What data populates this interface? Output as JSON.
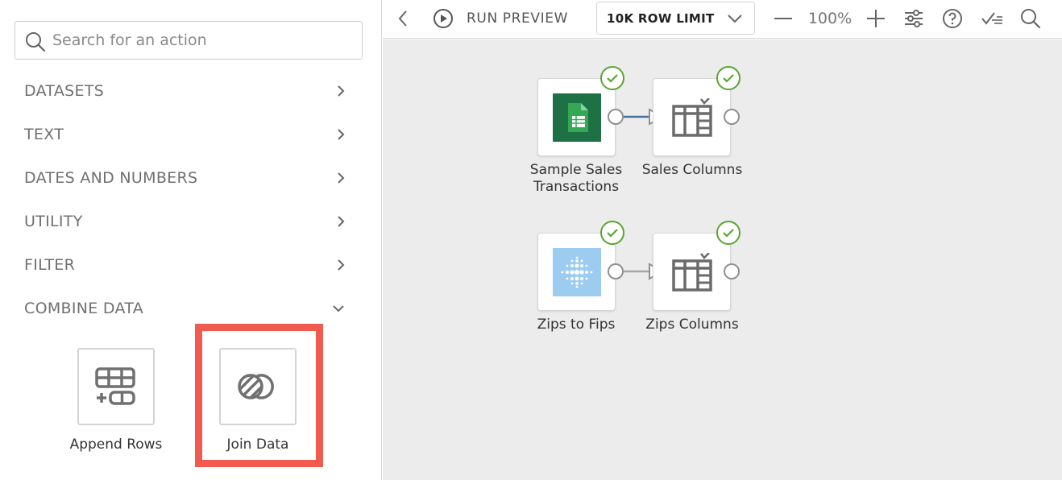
{
  "search": {
    "placeholder": "Search for an action"
  },
  "categories": [
    {
      "label": "DATASETS",
      "icon": "chevron-right-icon"
    },
    {
      "label": "TEXT",
      "icon": "chevron-right-icon"
    },
    {
      "label": "DATES AND NUMBERS",
      "icon": "chevron-right-icon"
    },
    {
      "label": "UTILITY",
      "icon": "chevron-right-icon"
    },
    {
      "label": "FILTER",
      "icon": "chevron-right-icon"
    },
    {
      "label": "COMBINE DATA",
      "icon": "chevron-down-icon"
    }
  ],
  "combine_actions": [
    {
      "label": "Append Rows",
      "icon": "append-rows-icon"
    },
    {
      "label": "Join Data",
      "icon": "join-data-icon",
      "highlighted": true
    }
  ],
  "toolbar": {
    "run_preview": "RUN PREVIEW",
    "row_limit": "10K ROW LIMIT",
    "zoom": "100%"
  },
  "flow": {
    "nodes": [
      {
        "label": "Sample Sales Transactions",
        "line1": "Sample Sales",
        "line2": "Transactions",
        "icon": "google-sheets-icon",
        "status": "success"
      },
      {
        "label": "Sales Columns",
        "icon": "select-columns-icon",
        "status": "success"
      },
      {
        "label": "Zips to Fips",
        "icon": "dataset-dots-icon",
        "status": "success"
      },
      {
        "label": "Zips Columns",
        "icon": "select-columns-icon",
        "status": "success"
      }
    ]
  },
  "colors": {
    "highlight": "#f05a4f",
    "success": "#5aa532",
    "sheets_green": "#1e7145",
    "wire_active": "#4a6f9a",
    "canvas_bg": "#ececec"
  }
}
